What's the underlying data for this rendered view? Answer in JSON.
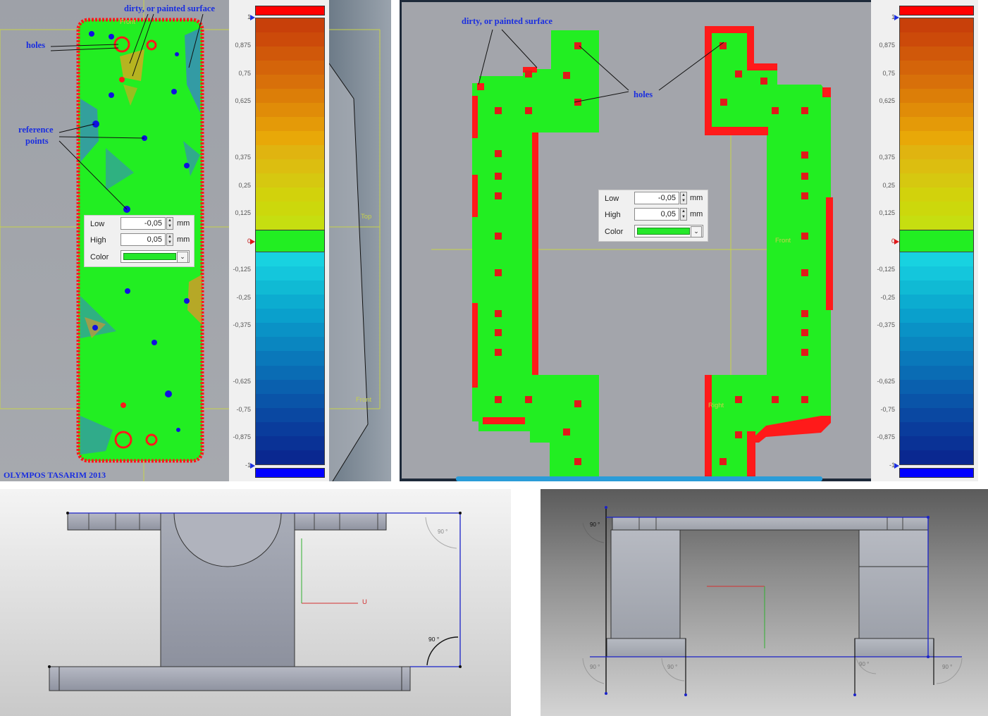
{
  "annotations_left": {
    "dirty": "dirty, or painted surface",
    "holes": "holes",
    "reference": "reference",
    "points": "points"
  },
  "annotations_right": {
    "dirty": "dirty, or painted surface",
    "holes": "holes"
  },
  "copyright": "OLYMPOS TASARIM 2013",
  "view_labels": {
    "front": "Front",
    "top": "Top",
    "right": "Right",
    "u_axis": "U"
  },
  "tolerance_panel": {
    "low_label": "Low",
    "high_label": "High",
    "color_label": "Color",
    "low_value": "-0,05",
    "high_value": "0,05",
    "unit": "mm",
    "color": "#25e82a"
  },
  "color_scale": {
    "ticks": [
      "1",
      "0,875",
      "0,75",
      "0,625",
      "0,375",
      "0,25",
      "0,125",
      "0",
      "-0,125",
      "-0,25",
      "-0,375",
      "-0,625",
      "-0,75",
      "-0,875",
      "-1"
    ],
    "tick_values": [
      1,
      0.875,
      0.75,
      0.625,
      0.375,
      0.25,
      0.125,
      0,
      -0.125,
      -0.25,
      -0.375,
      -0.625,
      -0.75,
      -0.875,
      -1
    ],
    "max_color": "#ff0000",
    "min_color": "#0000ff",
    "tolerance_color": "#22ee22",
    "warm_colors": [
      "#c8400a",
      "#cc4a0a",
      "#d0580a",
      "#d4640a",
      "#d8700a",
      "#dc7e08",
      "#e08c08",
      "#e49a08",
      "#e8a808",
      "#e0b410",
      "#dcbe10",
      "#d6c810",
      "#d2d20c",
      "#ccd80c",
      "#c6de10"
    ],
    "cool_colors": [
      "#18d2e0",
      "#14c6dc",
      "#10bad4",
      "#0cacd0",
      "#0aa0cc",
      "#0a92c6",
      "#0a86c0",
      "#0a78ba",
      "#0a6cb4",
      "#0a60ae",
      "#0a54a8",
      "#0a48a2",
      "#0a3c9c",
      "#0a3296",
      "#0a2890"
    ]
  },
  "angles": {
    "a1": "90 °",
    "a2": "90 °",
    "a3": "90 °",
    "a4": "90 °",
    "a5": "90 °",
    "a6": "90 °",
    "a7": "90 °"
  }
}
